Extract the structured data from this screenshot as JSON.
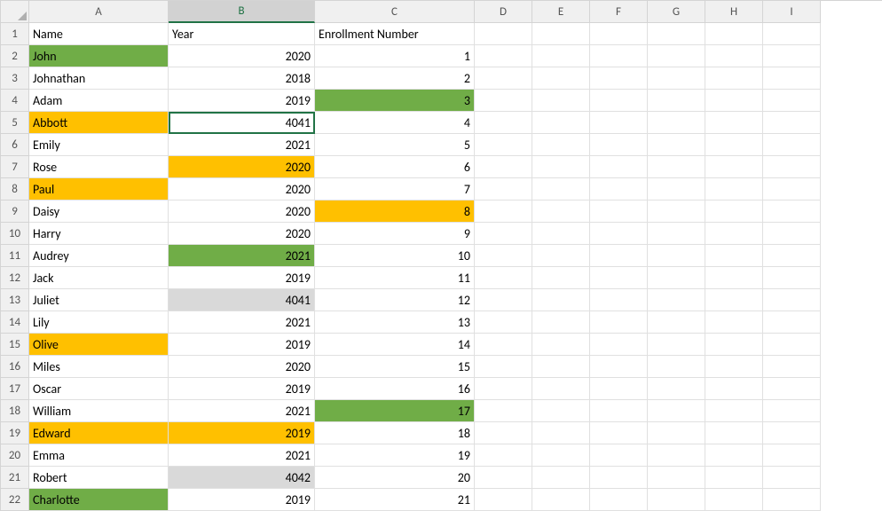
{
  "columns": [
    "A",
    "B",
    "C",
    "D",
    "E",
    "F",
    "G",
    "H",
    "I"
  ],
  "rowCount": 22,
  "activeCell": {
    "row": 5,
    "col": "B"
  },
  "headers": {
    "A": "Name",
    "B": "Year",
    "C": "Enrollment Number"
  },
  "rows": [
    {
      "n": 2,
      "name": "John",
      "year": 2020,
      "en": 1,
      "fill": {
        "A": "green"
      }
    },
    {
      "n": 3,
      "name": "Johnathan",
      "year": 2018,
      "en": 2,
      "fill": {}
    },
    {
      "n": 4,
      "name": "Adam",
      "year": 2019,
      "en": 3,
      "fill": {
        "C": "green"
      }
    },
    {
      "n": 5,
      "name": "Abbott",
      "year": 4041,
      "en": 4,
      "fill": {
        "A": "orange"
      }
    },
    {
      "n": 6,
      "name": "Emily",
      "year": 2021,
      "en": 5,
      "fill": {}
    },
    {
      "n": 7,
      "name": "Rose",
      "year": 2020,
      "en": 6,
      "fill": {
        "B": "orange"
      }
    },
    {
      "n": 8,
      "name": "Paul",
      "year": 2020,
      "en": 7,
      "fill": {
        "A": "orange"
      }
    },
    {
      "n": 9,
      "name": "Daisy",
      "year": 2020,
      "en": 8,
      "fill": {
        "C": "orange"
      }
    },
    {
      "n": 10,
      "name": "Harry",
      "year": 2020,
      "en": 9,
      "fill": {}
    },
    {
      "n": 11,
      "name": "Audrey",
      "year": 2021,
      "en": 10,
      "fill": {
        "B": "green"
      }
    },
    {
      "n": 12,
      "name": "Jack",
      "year": 2019,
      "en": 11,
      "fill": {}
    },
    {
      "n": 13,
      "name": "Juliet",
      "year": 4041,
      "en": 12,
      "fill": {
        "B": "grey"
      }
    },
    {
      "n": 14,
      "name": "Lily",
      "year": 2021,
      "en": 13,
      "fill": {}
    },
    {
      "n": 15,
      "name": "Olive",
      "year": 2019,
      "en": 14,
      "fill": {
        "A": "orange"
      }
    },
    {
      "n": 16,
      "name": "Miles",
      "year": 2020,
      "en": 15,
      "fill": {}
    },
    {
      "n": 17,
      "name": "Oscar",
      "year": 2019,
      "en": 16,
      "fill": {}
    },
    {
      "n": 18,
      "name": "William",
      "year": 2021,
      "en": 17,
      "fill": {
        "C": "green"
      }
    },
    {
      "n": 19,
      "name": "Edward",
      "year": 2019,
      "en": 18,
      "fill": {
        "A": "orange",
        "B": "orange"
      }
    },
    {
      "n": 20,
      "name": "Emma",
      "year": 2021,
      "en": 19,
      "fill": {}
    },
    {
      "n": 21,
      "name": "Robert",
      "year": 4042,
      "en": 20,
      "fill": {
        "B": "grey"
      }
    },
    {
      "n": 22,
      "name": "Charlotte",
      "year": 2019,
      "en": 21,
      "fill": {
        "A": "green"
      }
    }
  ],
  "chart_data": {
    "type": "table",
    "title": "",
    "columns": [
      "Name",
      "Year",
      "Enrollment Number"
    ],
    "records": [
      [
        "John",
        2020,
        1
      ],
      [
        "Johnathan",
        2018,
        2
      ],
      [
        "Adam",
        2019,
        3
      ],
      [
        "Abbott",
        4041,
        4
      ],
      [
        "Emily",
        2021,
        5
      ],
      [
        "Rose",
        2020,
        6
      ],
      [
        "Paul",
        2020,
        7
      ],
      [
        "Daisy",
        2020,
        8
      ],
      [
        "Harry",
        2020,
        9
      ],
      [
        "Audrey",
        2021,
        10
      ],
      [
        "Jack",
        2019,
        11
      ],
      [
        "Juliet",
        4041,
        12
      ],
      [
        "Lily",
        2021,
        13
      ],
      [
        "Olive",
        2019,
        14
      ],
      [
        "Miles",
        2020,
        15
      ],
      [
        "Oscar",
        2019,
        16
      ],
      [
        "William",
        2021,
        17
      ],
      [
        "Edward",
        2019,
        18
      ],
      [
        "Emma",
        2021,
        19
      ],
      [
        "Robert",
        4042,
        20
      ],
      [
        "Charlotte",
        2019,
        21
      ]
    ]
  }
}
